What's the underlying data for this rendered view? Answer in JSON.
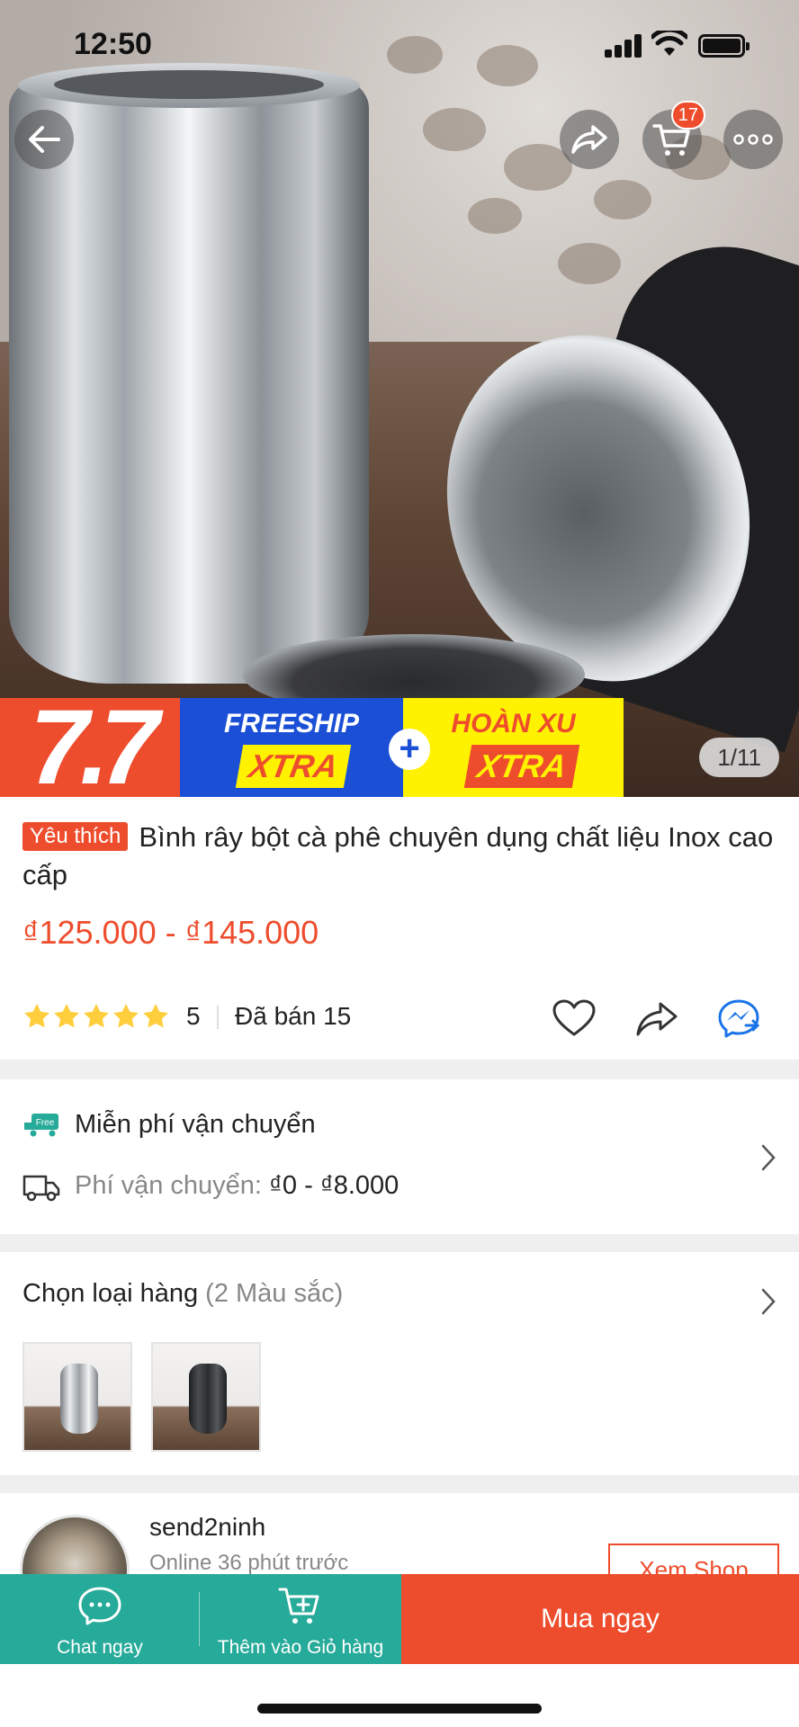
{
  "status_bar": {
    "time": "12:50"
  },
  "header": {
    "cart_count": "17"
  },
  "promo": {
    "sale_label": "7.7",
    "freeship_title": "FREESHIP",
    "freeship_xtra": "XTRA",
    "hoanxu_title": "HOÀN XU",
    "hoanxu_xtra": "XTRA",
    "plus": "+",
    "image_counter": "1/11"
  },
  "product": {
    "badge": "Yêu thích",
    "title": "Bình rây bột cà phê chuyên dụng chất liệu Inox cao cấp",
    "price": "₫125.000 - ₫145.000",
    "rating": "5",
    "rating_fraction": 1.0,
    "sold": "Đã bán 15"
  },
  "shipping": {
    "free_badge": "Free",
    "free_label": "Miễn phí vận chuyển",
    "fee_label": "Phí vận chuyển:",
    "fee_value": "₫0 - ₫8.000"
  },
  "variants": {
    "title": "Chọn loại hàng",
    "subtitle": "(2 Màu sắc)",
    "options": [
      "silver",
      "black"
    ]
  },
  "shop": {
    "name": "send2ninh",
    "online": "Online 36 phút trước",
    "view_label": "Xem Shop"
  },
  "bottom_bar": {
    "chat_label": "Chat ngay",
    "cart_label": "Thêm vào Giỏ hàng",
    "buy_label": "Mua ngay"
  },
  "colors": {
    "accent": "#ee4d2d",
    "teal": "#26aa99",
    "freeship_blue": "#1a4fd6",
    "xtra_yellow": "#fff200",
    "star": "#ffce3d"
  },
  "icons": [
    "back-icon",
    "share-icon",
    "cart-icon",
    "more-icon",
    "star-icon",
    "heart-icon",
    "messenger-icon",
    "free-truck-icon",
    "truck-icon",
    "chevron-right-icon",
    "chat-icon",
    "add-to-cart-icon"
  ]
}
